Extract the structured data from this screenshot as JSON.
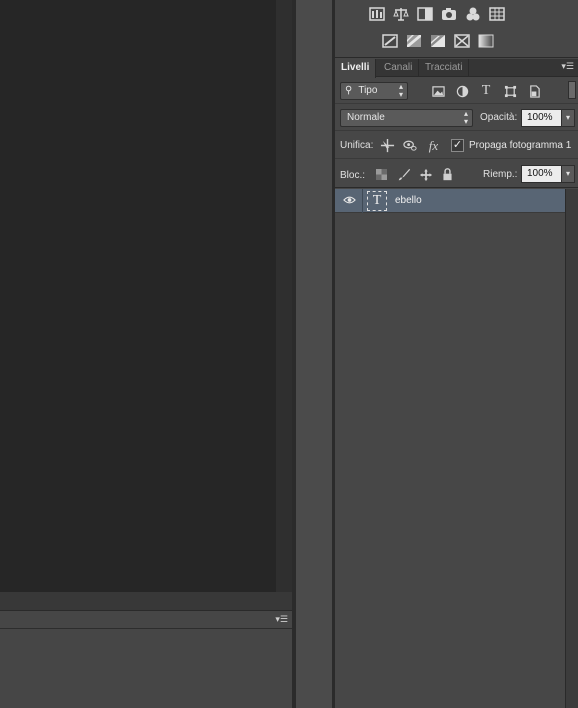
{
  "adjustments": {
    "row1_icons": [
      "levels-icon",
      "balance-icon",
      "black-white-icon",
      "camera-filter-icon",
      "channel-mixer-icon",
      "color-lookup-icon"
    ],
    "row2_icons": [
      "invert-icon",
      "posterize-icon",
      "threshold-icon",
      "gradient-map-icon",
      "selective-color-icon"
    ]
  },
  "tabs": [
    {
      "label": "Livelli",
      "active": true
    },
    {
      "label": "Canali",
      "active": false
    },
    {
      "label": "Tracciati",
      "active": false
    }
  ],
  "filter": {
    "kind_label": "Tipo",
    "icons": [
      "image-filter-icon",
      "adjustment-filter-icon",
      "type-filter-icon",
      "shape-filter-icon",
      "smart-object-filter-icon"
    ]
  },
  "blend": {
    "mode": "Normale",
    "opacity_label": "Opacità:",
    "opacity_value": "100%"
  },
  "unify": {
    "label": "Unifica:",
    "propagate_label": "Propaga fotogramma 1",
    "propagate_checked": true
  },
  "lock": {
    "label": "Bloc.:",
    "fill_label": "Riemp.:",
    "fill_value": "100%"
  },
  "layers": [
    {
      "name": "ebello",
      "type": "text",
      "thumb_glyph": "T",
      "visible": true,
      "selected": true
    }
  ],
  "colors": {
    "selected_layer": "#586574",
    "panel_bg": "#474747",
    "canvas_bg": "#262626"
  }
}
